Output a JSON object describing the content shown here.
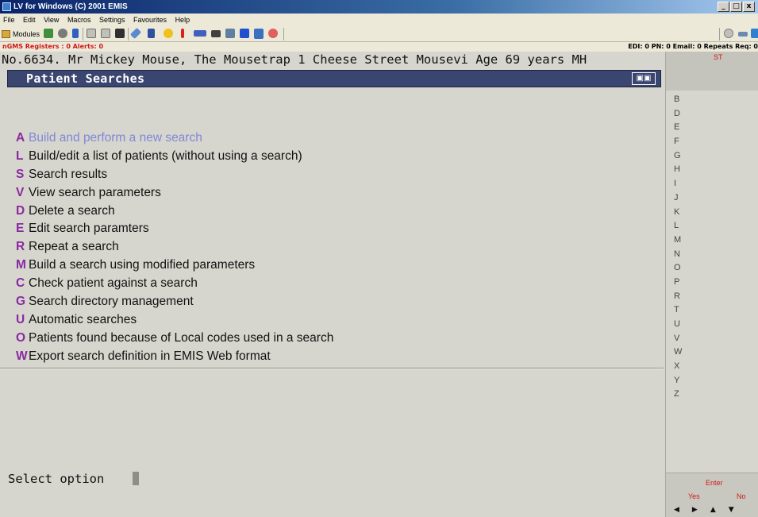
{
  "window": {
    "title": "LV for Windows (C) 2001 EMIS",
    "buttons": {
      "minimize": "_",
      "restore": "□",
      "close": "x"
    }
  },
  "menubar": [
    "File",
    "Edit",
    "View",
    "Macros",
    "Settings",
    "Favourites",
    "Help"
  ],
  "toolbar": {
    "modules_label": "Modules"
  },
  "statusline": {
    "left": "nGMS Registers : 0  Alerts: 0",
    "right": "EDI: 0  PN: 0  Email: 0  Repeats Req: 0"
  },
  "patient": {
    "line": "No.6634. Mr Mickey Mouse, The Mousetrap 1 Cheese Street Mousevi   Age 69 years MH"
  },
  "screen": {
    "title": "Patient Searches",
    "prompt": "Select option"
  },
  "menu": [
    {
      "key": "A",
      "label": "Build and perform a new search"
    },
    {
      "key": "L",
      "label": "Build/edit a list of patients (without using a search)"
    },
    {
      "key": "S",
      "label": "Search results"
    },
    {
      "key": "V",
      "label": "View search parameters"
    },
    {
      "key": "D",
      "label": "Delete a search"
    },
    {
      "key": "E",
      "label": "Edit search paramters"
    },
    {
      "key": "R",
      "label": "Repeat a search"
    },
    {
      "key": "M",
      "label": "Build a search using modified parameters"
    },
    {
      "key": "C",
      "label": "Check patient against a search"
    },
    {
      "key": "G",
      "label": "Search directory management"
    },
    {
      "key": "U",
      "label": "Automatic searches"
    },
    {
      "key": "O",
      "label": "Patients found because of Local codes used in a search"
    },
    {
      "key": "W",
      "label": "Export search definition in EMIS Web format"
    }
  ],
  "right_panel": {
    "tab": "ST",
    "letters": [
      "B",
      "D",
      "E",
      "F",
      "G",
      "H",
      "I",
      "J",
      "K",
      "L",
      "M",
      "N",
      "O",
      "P",
      "R",
      "T",
      "U",
      "V",
      "W",
      "X",
      "Y",
      "Z"
    ],
    "enter_label": "Enter",
    "yes_label": "Yes",
    "no_label": "No"
  }
}
